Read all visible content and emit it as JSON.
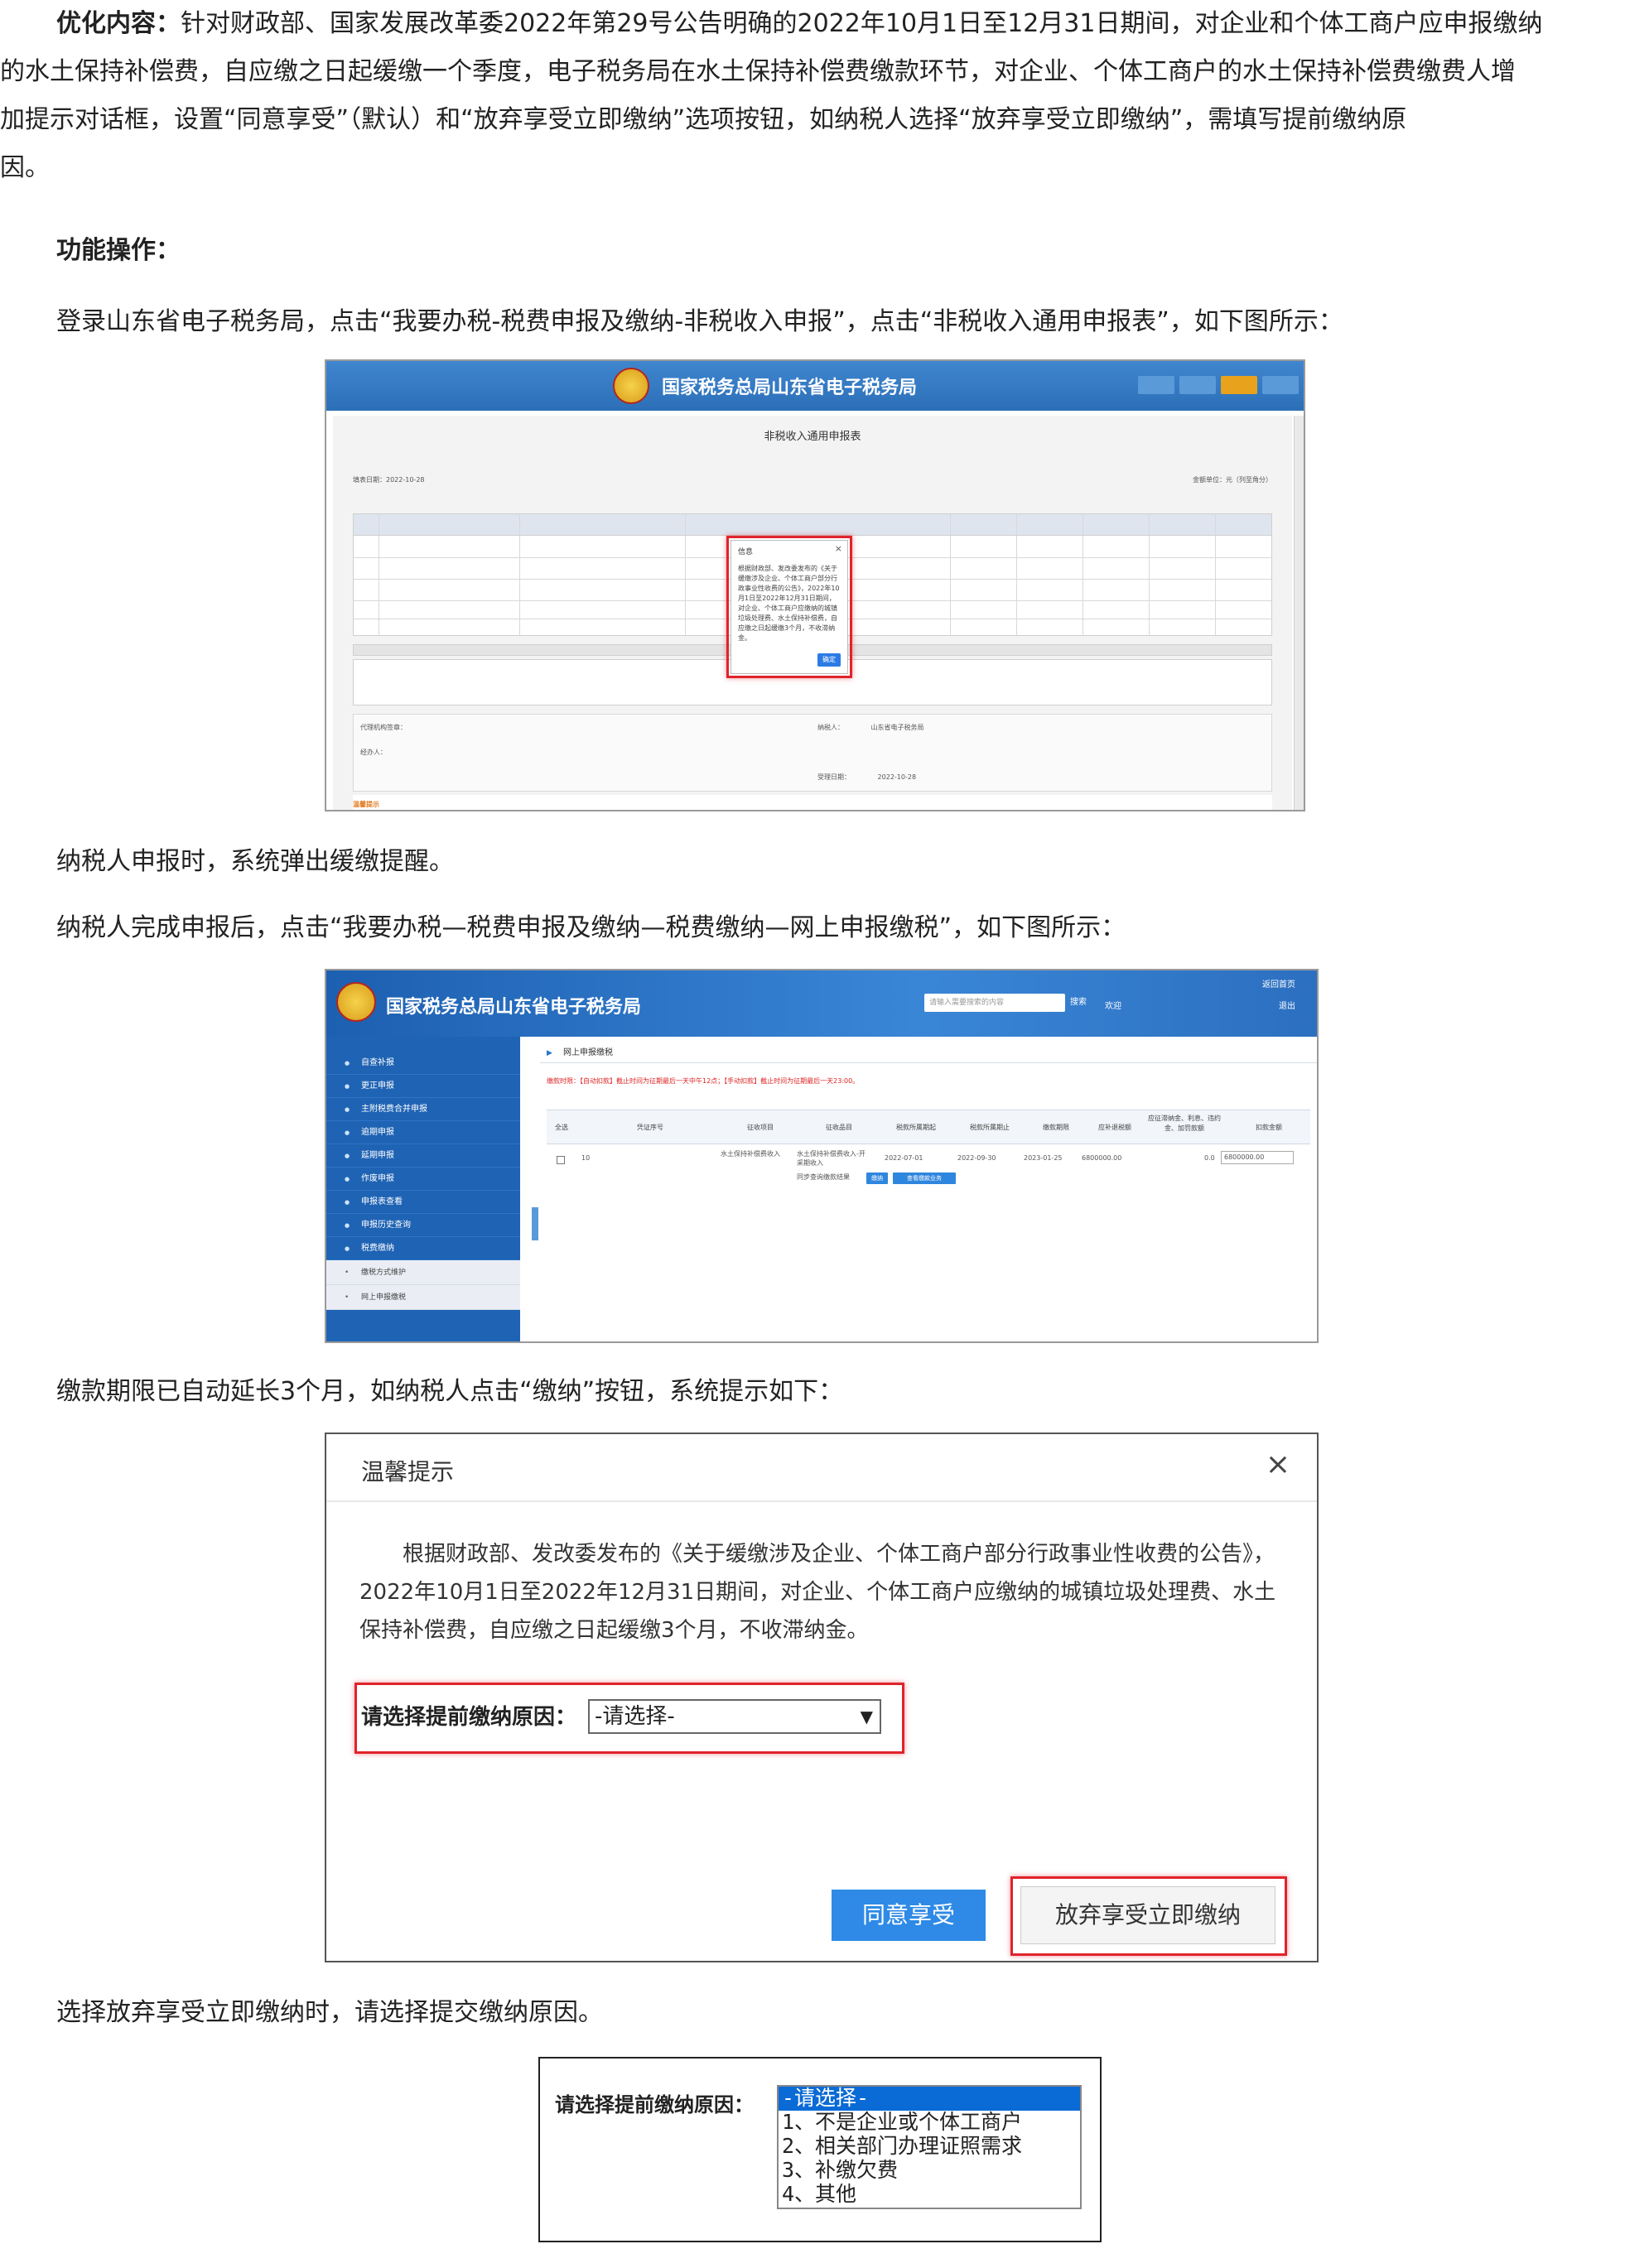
{
  "intro": {
    "label": "优化内容：",
    "line1": "针对财政部、国家发展改革委2022年第29号公告明确的2022年10月1日至12月31日期间，对企业和个体工商户应申报缴纳",
    "line2": "的水土保持补偿费，自应缴之日起缓缴一个季度，电子税务局在水土保持补偿费缴款环节，对企业、个体工商户的水土保持补偿费缴费人增",
    "line3": "加提示对话框，设置“同意享受”（默认）和“放弃享受立即缴纳”选项按钮，如纳税人选择“放弃享受立即缴纳”，需填写提前缴纳原",
    "line4": "因。"
  },
  "section_title": "功能操作：",
  "step1": "登录山东省电子税务局，点击“我要办税-税费申报及缴纳-非税收入申报”，点击“非税收入通用申报表”，如下图所示：",
  "screenshot1": {
    "site_title": "国家税务总局山东省电子税务局",
    "form_title": "非税收入通用申报表",
    "date_label": "填表日期：",
    "date_value": "2022-10-28",
    "unit_label": "金额单位：元（列至角分）",
    "dialog": {
      "title": "信息",
      "close": "×",
      "body": "根据财政部、发改委发布的《关于缓缴涉及企业、个体工商户部分行政事业性收费的公告》，2022年10月1日至2022年12月31日期间，对企业、个体工商户应缴纳的城镇垃圾处理费、水土保持补偿费，自应缴之日起缓缴3个月，不收滞纳金。",
      "ok": "确定"
    },
    "agent_label": "代理机构签章：",
    "handler_label": "经办人：",
    "taxpayer_label": "纳税人：",
    "taxpayer_value": "山东省电子税务局",
    "accept_date_label": "受理日期：",
    "accept_date_value": "2022-10-28",
    "warn_label": "温馨提示"
  },
  "step2": "纳税人申报时，系统弹出缓缴提醒。",
  "step3": "纳税人完成申报后，点击“我要办税—税费申报及缴纳—税费缴纳—网上申报缴税”，如下图所示：",
  "screenshot2": {
    "site_title": "国家税务总局山东省电子税务局",
    "search_placeholder": "请输入需要搜索的内容",
    "search_button": "搜索",
    "welcome": "欢迎",
    "home_link": "返回首页",
    "exit_link": "退出",
    "sidebar": [
      "自查补报",
      "更正申报",
      "主附税费合并申报",
      "逾期申报",
      "延期申报",
      "作废申报",
      "申报表查看",
      "申报历史查询",
      "税费缴纳"
    ],
    "sidebar_sub": [
      "缴税方式维护",
      "网上申报缴税"
    ],
    "breadcrumb": "网上申报缴税",
    "alert": "缴款时限：【自动扣款】截止时间为征期最后一天中午12点；【手动扣款】截止时间为征期最后一天23:00。",
    "headers": [
      "全选",
      "凭证序号",
      "征收项目",
      "征收品目",
      "税款所属期起",
      "税款所属期止",
      "缴款期限",
      "应补退税额",
      "应征滞纳金、利息、违约金、加罚款额",
      "扣款金额"
    ],
    "row": {
      "voucher": "10",
      "item": "水土保持补偿费收入",
      "sub_item": "水土保持补偿费收入-开采期收入",
      "start": "2022-07-01",
      "end": "2022-09-30",
      "deadline": "2023-01-25",
      "amount": "6800000.00",
      "late": "0.0",
      "pay": "6800000.00"
    },
    "pay_btn": "缴纳",
    "query_btn": "查看缴款业务",
    "sync_label": "同步查询缴款结果"
  },
  "step4": "缴款期限已自动延长3个月，如纳税人点击“缴纳”按钮，系统提示如下：",
  "screenshot3": {
    "title": "温馨提示",
    "close": "×",
    "body": "根据财政部、发改委发布的《关于缓缴涉及企业、个体工商户部分行政事业性收费的公告》，2022年10月1日至2022年12月31日期间，对企业、个体工商户应缴纳的城镇垃圾处理费、水土保持补偿费，自应缴之日起缓缴3个月，不收滞纳金。",
    "reason_label": "请选择提前缴纳原因：",
    "reason_value": "-请选择-",
    "agree_btn": "同意享受",
    "giveup_btn": "放弃享受立即缴纳"
  },
  "step5": "选择放弃享受立即缴纳时，请选择提交缴纳原因。",
  "screenshot4": {
    "label": "请选择提前缴纳原因：",
    "options": [
      "-请选择-",
      "1、不是企业或个体工商户",
      "2、相关部门办理证照需求",
      "3、补缴欠费",
      "4、其他"
    ]
  },
  "colors": {
    "header_blue": "#2c6fb8",
    "highlight_red": "#e0232b",
    "button_blue": "#2e8ae6",
    "select_blue": "#0a6ad6"
  }
}
